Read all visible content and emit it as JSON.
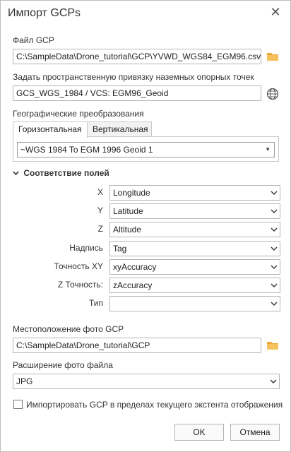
{
  "dialog": {
    "title": "Импорт GCPs"
  },
  "gcp_file": {
    "label": "Файл GCP",
    "value": "C:\\SampleData\\Drone_tutorial\\GCP\\YVWD_WGS84_EGM96.csv"
  },
  "spatial_reference": {
    "label": "Задать пространственную привязку наземных опорных точек",
    "value": "GCS_WGS_1984 / VCS: EGM96_Geoid"
  },
  "geo_transform": {
    "label": "Географические преобразования",
    "tabs": [
      "Горизонтальная",
      "Вертикальная"
    ],
    "value": "~WGS 1984 To EGM 1996 Geoid 1"
  },
  "field_mapping": {
    "title": "Соответствие полей",
    "rows": [
      {
        "label": "X",
        "value": "Longitude"
      },
      {
        "label": "Y",
        "value": "Latitude"
      },
      {
        "label": "Z",
        "value": "Altitude"
      },
      {
        "label": "Надпись",
        "value": "Tag"
      },
      {
        "label": "Точность XY",
        "value": "xyAccuracy"
      },
      {
        "label": "Z Точность:",
        "value": "zAccuracy"
      },
      {
        "label": "Тип",
        "value": ""
      }
    ]
  },
  "photo_location": {
    "label": "Местоположение фото GCP",
    "value": "C:\\SampleData\\Drone_tutorial\\GCP"
  },
  "photo_extension": {
    "label": "Расширение фото файла",
    "value": "JPG"
  },
  "import_extent": {
    "label": "Импортировать GCP в пределах текущего экстента отображения",
    "checked": false
  },
  "buttons": {
    "ok": "OK",
    "cancel": "Отмена"
  },
  "colors": {
    "folder": "#e8a735",
    "border": "#b5b5b5",
    "tab_inactive": "#f2f2f2"
  },
  "icons": [
    "close-icon",
    "folder-icon",
    "globe-icon",
    "chevron-down-icon",
    "caret-down-icon"
  ]
}
